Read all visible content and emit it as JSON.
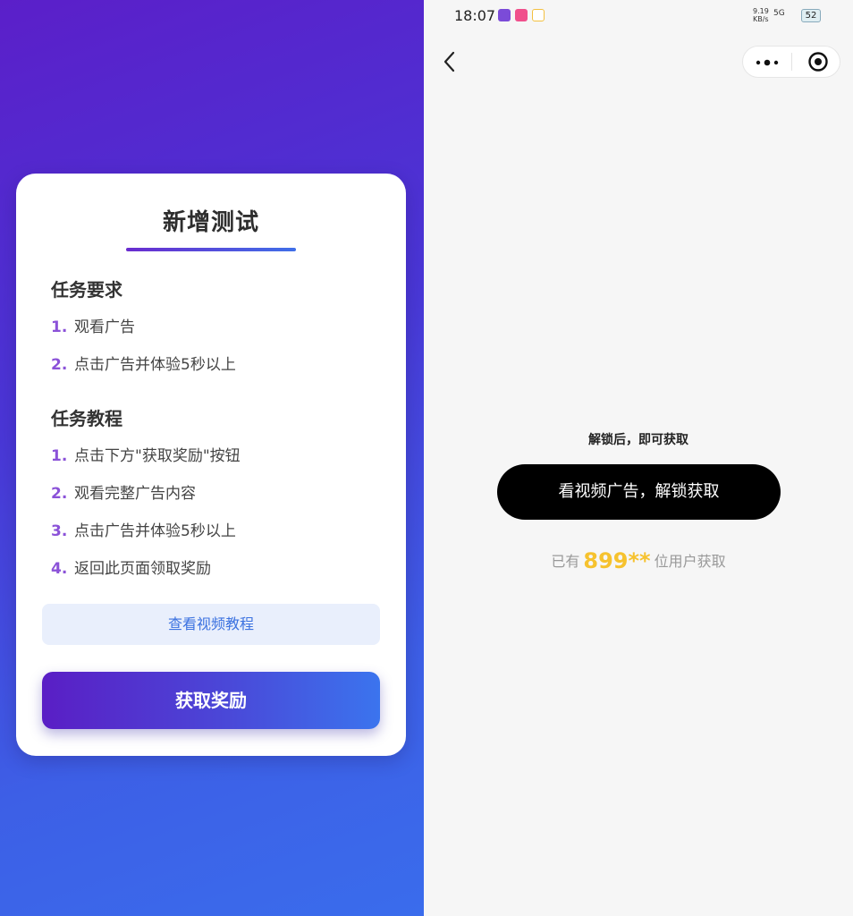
{
  "left": {
    "card": {
      "title": "新增测试",
      "requirements_heading": "任务要求",
      "requirements": [
        {
          "num": "1.",
          "text": "观看广告"
        },
        {
          "num": "2.",
          "text": "点击广告并体验5秒以上"
        }
      ],
      "tutorial_heading": "任务教程",
      "tutorial": [
        {
          "num": "1.",
          "text": "点击下方\"获取奖励\"按钮"
        },
        {
          "num": "2.",
          "text": "观看完整广告内容"
        },
        {
          "num": "3.",
          "text": "点击广告并体验5秒以上"
        },
        {
          "num": "4.",
          "text": "返回此页面领取奖励"
        }
      ],
      "video_button": "查看视频教程",
      "reward_button": "获取奖励"
    },
    "colors": {
      "gradient_start": "#5b1fc9",
      "gradient_end": "#3a6cec",
      "step_number": "#8b52d8"
    }
  },
  "right": {
    "status_bar": {
      "time": "18:07",
      "speed_value": "9.19",
      "speed_unit": "KB/s",
      "network": "5G",
      "battery": "52"
    },
    "nav": {
      "back_icon": "chevron-left-icon",
      "more_icon": "more-dots-icon",
      "close_icon": "target-close-icon"
    },
    "unlock_hint": "解锁后，即可获取",
    "watch_button": "看视频广告，解锁获取",
    "count_prefix": "已有",
    "count_value": "899**",
    "count_suffix": "位用户获取",
    "colors": {
      "count_accent": "#f6c22e",
      "button_bg": "#000000"
    }
  }
}
